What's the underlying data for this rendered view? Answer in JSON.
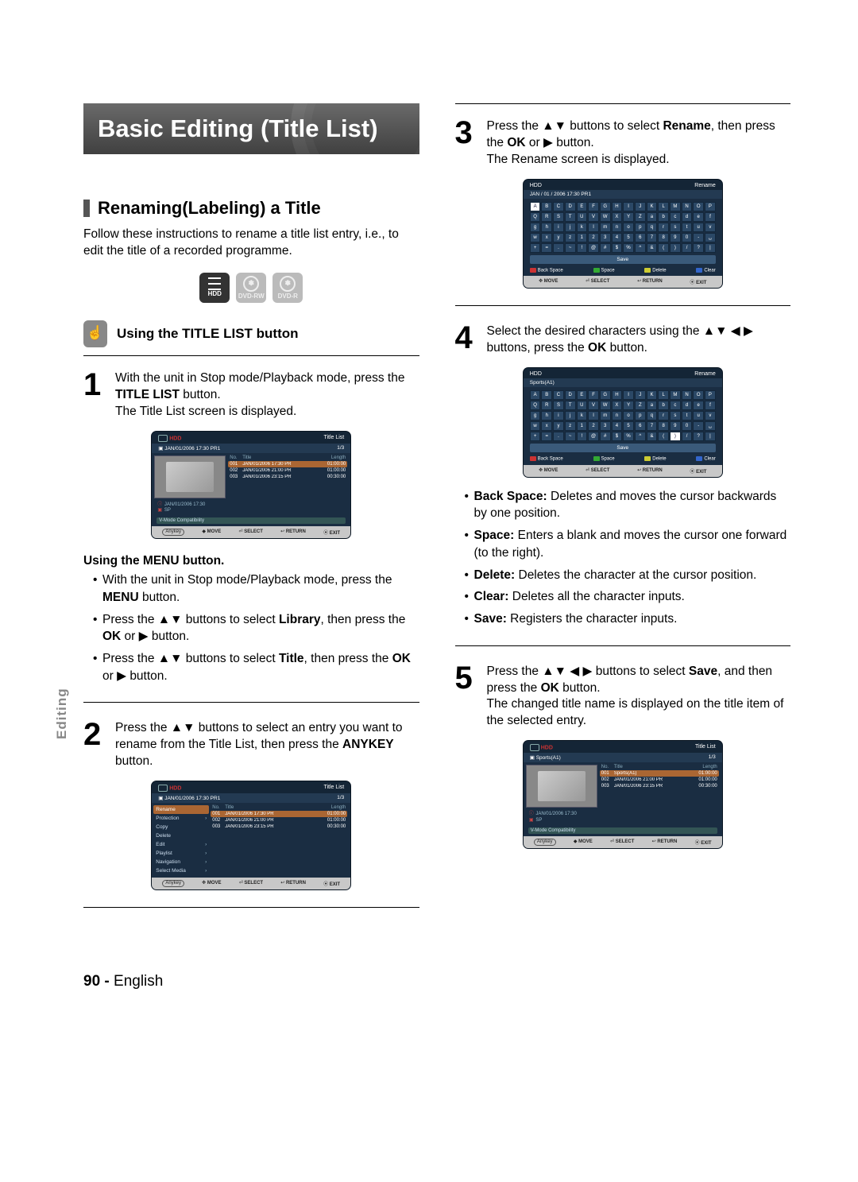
{
  "sidebar_label": "Editing",
  "main_title": "Basic Editing (Title List)",
  "section_title": "Renaming(Labeling) a Title",
  "section_intro": "Follow these instructions to rename a title list entry, i.e., to edit the title of a recorded programme.",
  "media": {
    "hdd": "HDD",
    "dvdrw": "DVD-RW",
    "dvdr": "DVD-R"
  },
  "subsection_title": "Using the TITLE LIST button",
  "step1": {
    "num": "1",
    "text_a": "With the unit in Stop mode/Playback mode, press the ",
    "bold_a": "TITLE LIST",
    "text_b": " button.",
    "text_c": "The Title List screen is displayed."
  },
  "menu_block": {
    "heading": "Using the MENU button.",
    "b1a": "With the unit in Stop mode/Playback mode, press the ",
    "b1b": "MENU",
    "b1c": " button.",
    "b2a": "Press the ▲▼ buttons to select ",
    "b2b": "Library",
    "b2c": ", then press the ",
    "b2d": "OK",
    "b2e": " or ▶ button.",
    "b3a": "Press the ▲▼ buttons to select ",
    "b3b": "Title",
    "b3c": ", then press the ",
    "b3d": "OK",
    "b3e": " or ▶ button."
  },
  "step2": {
    "num": "2",
    "text_a": "Press the ▲▼ buttons to select an entry you want to rename from the Title List, then press the ",
    "bold_a": "ANYKEY",
    "text_b": " button."
  },
  "step3": {
    "num": "3",
    "text_a": "Press the ▲▼ buttons to select ",
    "bold_a": "Rename",
    "text_b": ", then press the ",
    "bold_b": "OK",
    "text_c": " or ▶ button.",
    "text_d": "The Rename screen is displayed."
  },
  "step4": {
    "num": "4",
    "text_a": "Select the desired characters using the ▲▼ ◀ ▶ buttons, press the ",
    "bold_a": "OK",
    "text_b": " button."
  },
  "fn_bullets": {
    "bs_b": "Back Space:",
    "bs_t": " Deletes and moves the cursor backwards by one position.",
    "sp_b": "Space:",
    "sp_t": " Enters a blank and moves the cursor one forward (to the right).",
    "de_b": "Delete:",
    "de_t": " Deletes the character at the cursor position.",
    "cl_b": "Clear:",
    "cl_t": " Deletes all the character inputs.",
    "sv_b": "Save:",
    "sv_t": " Registers the character inputs."
  },
  "step5": {
    "num": "5",
    "text_a": "Press the ▲▼ ◀ ▶ buttons to select ",
    "bold_a": "Save",
    "text_b": ", and then press the ",
    "bold_b": "OK",
    "text_c": " button.",
    "text_d": "The changed title name is displayed on the title item of the selected entry."
  },
  "footer": {
    "page": "90 -",
    "lang": "English"
  },
  "osd_common": {
    "hdd": "HDD",
    "title_list": "Title List",
    "rename": "Rename",
    "frac": "1/3",
    "info1": "JAN/01/2006 17:30 PR1",
    "cols": {
      "no": "No.",
      "title": "Title",
      "length": "Length"
    },
    "rows": [
      {
        "no": "001",
        "title": "JAN/01/2006 17:30 PR",
        "len": "01:00:00"
      },
      {
        "no": "002",
        "title": "JAN/01/2006 21:00 PR",
        "len": "01:00:00"
      },
      {
        "no": "003",
        "title": "JAN/01/2006 23:15 PR",
        "len": "00:30:00"
      }
    ],
    "rows_sports": [
      {
        "no": "001",
        "title": "Sports(A1)",
        "len": "01:00:00"
      },
      {
        "no": "002",
        "title": "JAN/01/2006 21:00 PR",
        "len": "01:00:00"
      },
      {
        "no": "003",
        "title": "JAN/01/2006 23:15 PR",
        "len": "00:30:00"
      }
    ],
    "meta": {
      "date": "JAN/01/2006 17:30",
      "sp": "SP",
      "vmode": "V-Mode Compatibility"
    },
    "hints": {
      "anykey": "Anykey",
      "move": "MOVE",
      "select": "SELECT",
      "return": "RETURN",
      "exit": "EXIT"
    },
    "side_menu": [
      "Rename",
      "Protection",
      "Copy",
      "Delete",
      "Edit",
      "Playlist",
      "Navigation",
      "Select Media"
    ],
    "kbd": {
      "label1": "JAN / 01 / 2006   17:30   PR1",
      "label2": "Sports(A1)",
      "save": "Save",
      "fn": {
        "bs": "Back Space",
        "sp": "Space",
        "de": "Delete",
        "cl": "Clear"
      },
      "rows": [
        [
          "A",
          "B",
          "C",
          "D",
          "E",
          "F",
          "G",
          "H",
          "I",
          "J",
          "K",
          "L",
          "M",
          "N",
          "O",
          "P"
        ],
        [
          "Q",
          "R",
          "S",
          "T",
          "U",
          "V",
          "W",
          "X",
          "Y",
          "Z",
          "a",
          "b",
          "c",
          "d",
          "e",
          "f"
        ],
        [
          "g",
          "h",
          "i",
          "j",
          "k",
          "l",
          "m",
          "n",
          "o",
          "p",
          "q",
          "r",
          "s",
          "t",
          "u",
          "v"
        ],
        [
          "w",
          "x",
          "y",
          "z",
          "1",
          "2",
          "3",
          "4",
          "5",
          "6",
          "7",
          "8",
          "9",
          "0",
          "-",
          "␣"
        ],
        [
          "+",
          "=",
          ".",
          "~",
          "!",
          "@",
          "#",
          "$",
          "%",
          "^",
          "&",
          "(",
          ")",
          "/",
          "?",
          "|"
        ]
      ]
    }
  }
}
